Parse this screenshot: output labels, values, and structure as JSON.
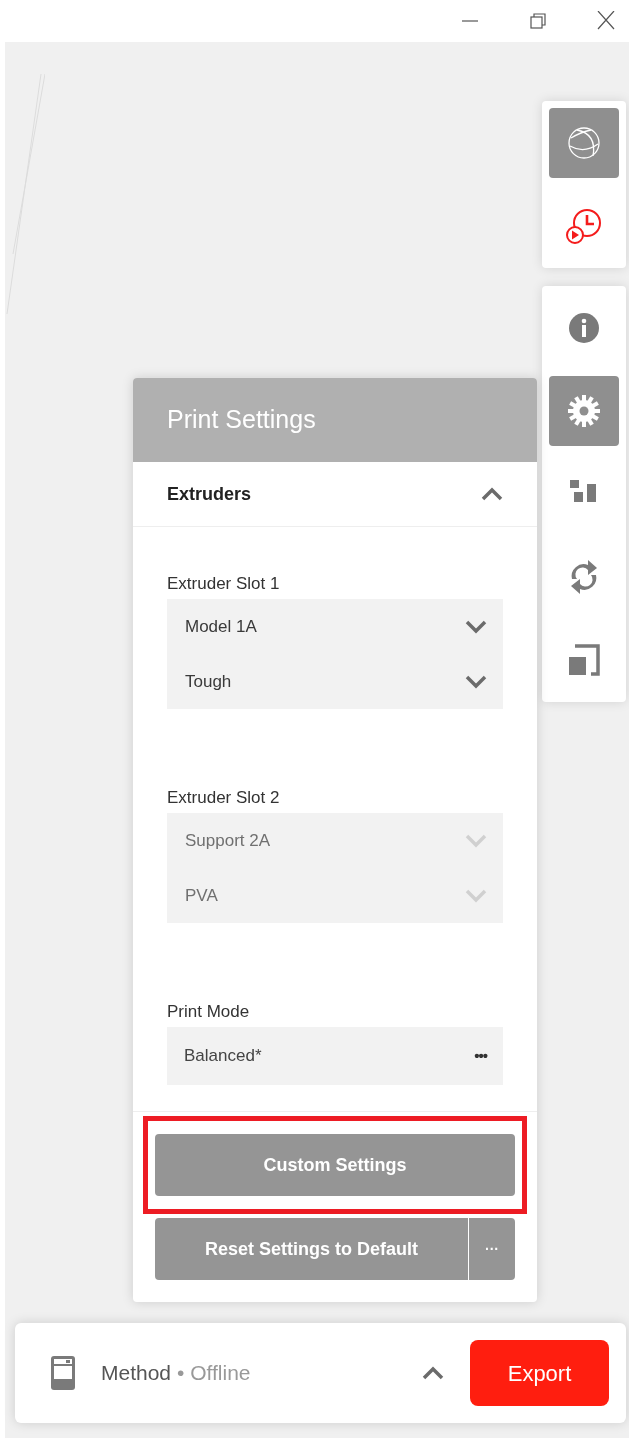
{
  "window_controls": [
    {
      "kind": "minimize"
    },
    {
      "kind": "restore"
    },
    {
      "kind": "close"
    }
  ],
  "toolbar_groups": [
    [
      {
        "kind": "globe",
        "selected": true
      },
      {
        "kind": "history",
        "selected": false
      }
    ],
    [
      {
        "kind": "info",
        "selected": false
      },
      {
        "kind": "settings",
        "selected": true
      },
      {
        "kind": "arrange",
        "selected": false
      },
      {
        "kind": "rotate",
        "selected": false
      },
      {
        "kind": "scale",
        "selected": false
      }
    ]
  ],
  "panel": {
    "title": "Print Settings",
    "section": {
      "title": "Extruders",
      "expanded": true
    },
    "groups": [
      {
        "label": "Extruder Slot 1",
        "kind": "dropdowns",
        "fields": [
          {
            "value": "Model 1A",
            "disabled": false
          },
          {
            "value": "Tough",
            "disabled": false
          }
        ]
      },
      {
        "label": "Extruder Slot 2",
        "kind": "dropdowns",
        "fields": [
          {
            "value": "Support 2A",
            "disabled": true
          },
          {
            "value": "PVA",
            "disabled": true
          }
        ]
      },
      {
        "label": "Print Mode",
        "kind": "menu",
        "fields": [
          {
            "value": "Balanced*"
          }
        ],
        "menu": "•••"
      }
    ],
    "custom_button": {
      "label": "Custom Settings",
      "highlighted": true
    },
    "reset_button": {
      "label": "Reset Settings to Default",
      "more": "···"
    }
  },
  "status_bar": {
    "printer": "Method",
    "status": "• Offline",
    "expanded": false,
    "export": "Export"
  }
}
